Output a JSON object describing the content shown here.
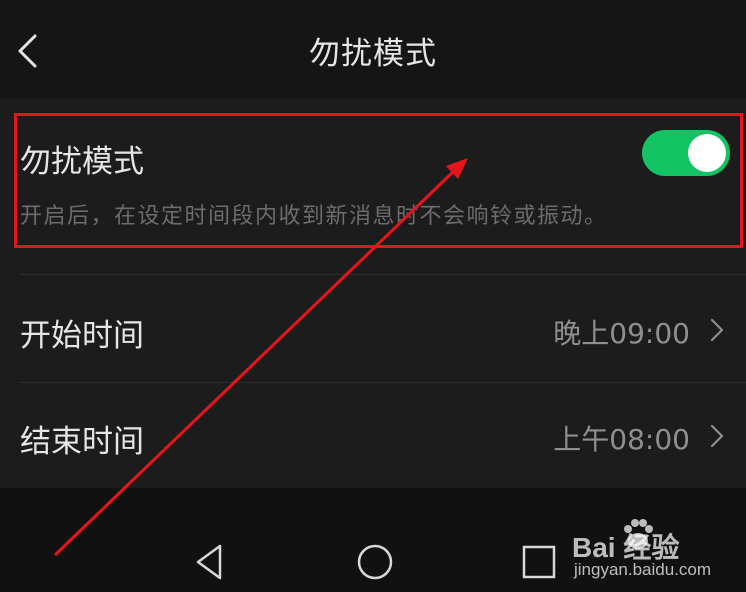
{
  "header": {
    "title": "勿扰模式"
  },
  "settings": {
    "dnd": {
      "label": "勿扰模式",
      "description": "开启后，在设定时间段内收到新消息时不会响铃或振动。",
      "enabled": true,
      "toggle_color": "#13c263"
    },
    "start_time": {
      "label": "开始时间",
      "value": "晚上09:00"
    },
    "end_time": {
      "label": "结束时间",
      "value": "上午08:00"
    }
  },
  "annotation": {
    "color": "#e8141c"
  },
  "watermark": {
    "brand_text": "Bai 经验",
    "url": "jingyan.baidu.com"
  }
}
